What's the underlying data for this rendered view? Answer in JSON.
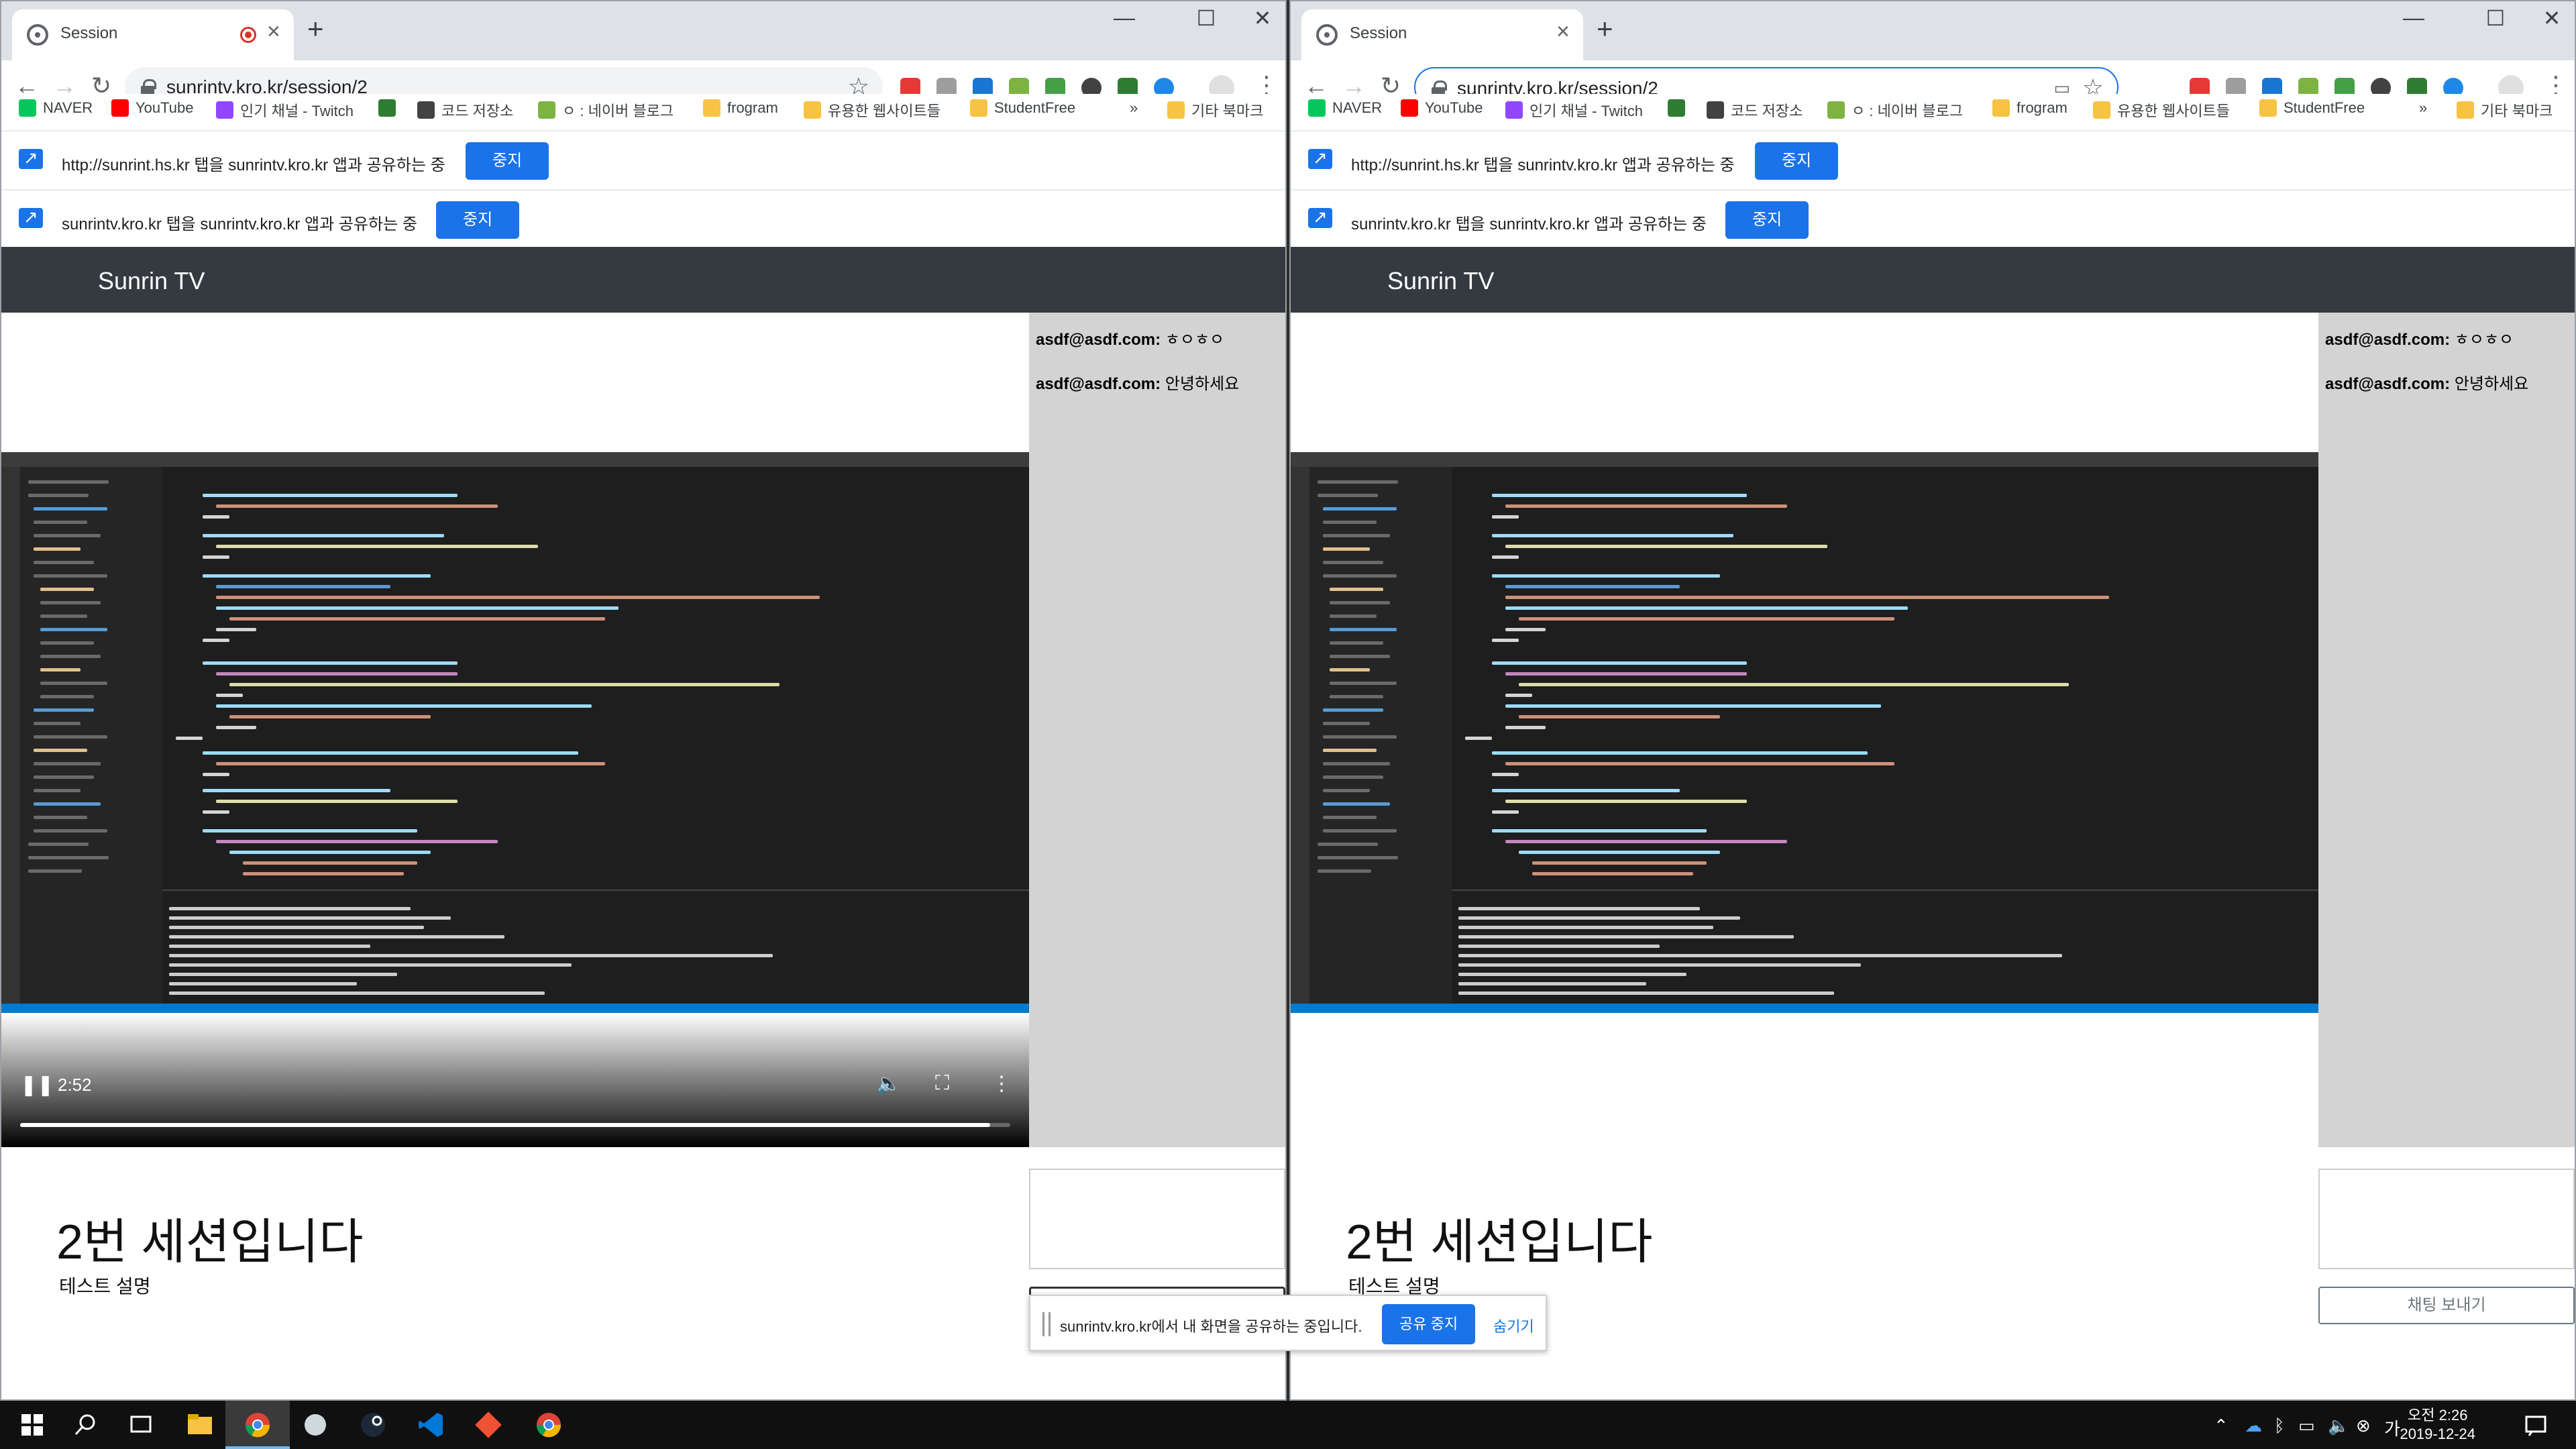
{
  "browser": {
    "tab_title": "Session",
    "url": "sunrintv.kro.kr/session/2",
    "bookmarks": [
      "NAVER",
      "YouTube",
      "인기 채널 - Twitch",
      "코드 저장소",
      "ㅇ : 네이버 블로그",
      "frogram",
      "유용한 웹사이트들",
      "StudentFree",
      "»",
      "기타 북마크"
    ],
    "infobars": [
      {
        "message": "http://sunrint.hs.kr 탭을 sunrintv.kro.kr 앱과 공유하는 중",
        "button": "중지"
      },
      {
        "message": "sunrintv.kro.kr 탭을 sunrintv.kro.kr 앱과 공유하는 중",
        "button": "중지"
      }
    ]
  },
  "site": {
    "brand": "Sunrin TV",
    "session_title": "2번 세션입니다",
    "session_description": "테스트 설명",
    "send_button": "채팅 보내기",
    "chat": [
      {
        "user": "asdf@asdf.com:",
        "text": "ㅎㅇㅎㅇ"
      },
      {
        "user": "asdf@asdf.com:",
        "text": "안녕하세요"
      }
    ],
    "video": {
      "time": "2:52",
      "progress": 0.98
    }
  },
  "share_notice": {
    "message": "sunrintv.kro.kr에서 내 화면을 공유하는 중입니다.",
    "stop_button": "공유 중지",
    "hide_button": "숨기기"
  },
  "taskbar": {
    "time": "오전 2:26",
    "date": "2019-12-24"
  },
  "colors": {
    "header_bg": "#343a40",
    "chat_bg": "#d3d3d3",
    "accent": "#1a73e8",
    "vscode_bg": "#1e1e1e",
    "vscode_status": "#007acc"
  }
}
